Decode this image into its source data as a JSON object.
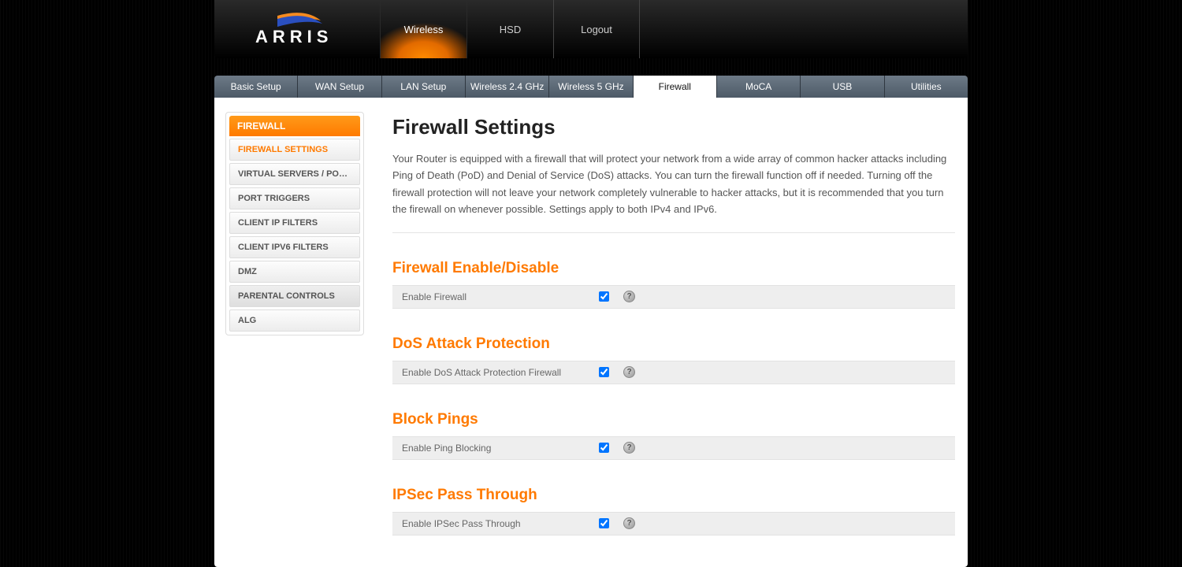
{
  "brand": "ARRIS",
  "topnav": {
    "items": [
      {
        "label": "Wireless",
        "active": true
      },
      {
        "label": "HSD",
        "active": false
      },
      {
        "label": "Logout",
        "active": false
      }
    ]
  },
  "tabs": [
    {
      "label": "Basic Setup"
    },
    {
      "label": "WAN Setup"
    },
    {
      "label": "LAN Setup"
    },
    {
      "label": "Wireless 2.4 GHz"
    },
    {
      "label": "Wireless 5 GHz"
    },
    {
      "label": "Firewall",
      "active": true
    },
    {
      "label": "MoCA"
    },
    {
      "label": "USB"
    },
    {
      "label": "Utilities"
    }
  ],
  "sidebar": {
    "header": "FIREWALL",
    "items": [
      {
        "label": "FIREWALL SETTINGS",
        "active": true
      },
      {
        "label": "VIRTUAL SERVERS / PORT ..."
      },
      {
        "label": "PORT TRIGGERS"
      },
      {
        "label": "CLIENT IP FILTERS"
      },
      {
        "label": "CLIENT IPV6 FILTERS"
      },
      {
        "label": "DMZ"
      },
      {
        "label": "PARENTAL CONTROLS",
        "dim": true
      },
      {
        "label": "ALG"
      }
    ]
  },
  "page": {
    "title": "Firewall Settings",
    "intro": "Your Router is equipped with a firewall that will protect your network from a wide array of common hacker attacks including Ping of Death (PoD) and Denial of Service (DoS) attacks. You can turn the firewall function off if needed. Turning off the firewall protection will not leave your network completely vulnerable to hacker attacks, but it is recommended that you turn the firewall on whenever possible. Settings apply to both IPv4 and IPv6."
  },
  "sections": [
    {
      "heading": "Firewall Enable/Disable",
      "label": "Enable Firewall",
      "checked": true
    },
    {
      "heading": "DoS Attack Protection",
      "label": "Enable DoS Attack Protection Firewall",
      "checked": true
    },
    {
      "heading": "Block Pings",
      "label": "Enable Ping Blocking",
      "checked": true
    },
    {
      "heading": "IPSec Pass Through",
      "label": "Enable IPSec Pass Through",
      "checked": true
    }
  ],
  "help_glyph": "?"
}
